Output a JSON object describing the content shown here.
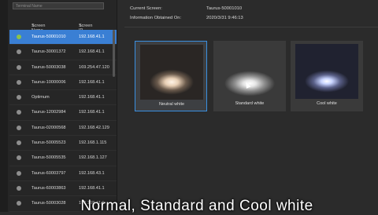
{
  "sidebar": {
    "search_placeholder": "Terminal Name",
    "columns": {
      "name": "Screen Name",
      "ip": "Screen IP"
    },
    "rows": [
      {
        "name": "Taurus-50001010",
        "ip": "192.168.41.1"
      },
      {
        "name": "Taurus-30001372",
        "ip": "192.168.41.1"
      },
      {
        "name": "Taurus-50003038",
        "ip": "169.254.47.120"
      },
      {
        "name": "Taurus-10000006",
        "ip": "192.168.41.1"
      },
      {
        "name": "Optimum",
        "ip": "192.168.41.1"
      },
      {
        "name": "Taurus-12002984",
        "ip": "192.168.41.1"
      },
      {
        "name": "Taurus-02000568",
        "ip": "192.168.42.129"
      },
      {
        "name": "Taurus-50005523",
        "ip": "192.168.1.115"
      },
      {
        "name": "Taurus-50005535",
        "ip": "192.168.1.127"
      },
      {
        "name": "Taurus-60003797",
        "ip": "192.168.43.1"
      },
      {
        "name": "Taurus-60003863",
        "ip": "192.168.41.1"
      },
      {
        "name": "Taurus-50003028",
        "ip": "192.168.41.1"
      }
    ]
  },
  "info": {
    "current_screen_label": "Current Screen:",
    "current_screen_value": "Taurus-50001010",
    "obtained_label": "Information Obtained On:",
    "obtained_value": "2020/3/31 9:46:13"
  },
  "presets": [
    {
      "label": "Neutral white",
      "selected": true
    },
    {
      "label": "Standard white",
      "selected": false
    },
    {
      "label": "Cool white",
      "selected": false
    }
  ],
  "caption": "Normal, Standard and Cool white"
}
